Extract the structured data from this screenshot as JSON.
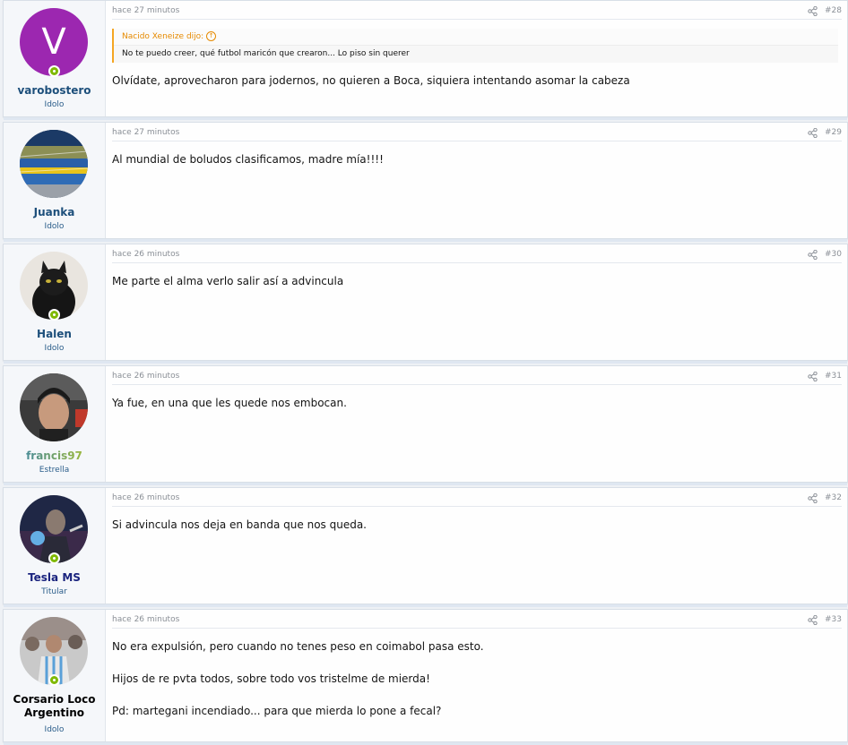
{
  "posts": [
    {
      "username": "varobostero",
      "user_title": "Idolo",
      "online": true,
      "time": "hace 27 minutos",
      "number": "#28",
      "quote": {
        "author": "Nacido Xeneize dijo:",
        "text": "No te puedo creer, qué futbol maricón que crearon... Lo piso sin querer"
      },
      "paragraphs": [
        "Olvídate, aprovecharon para jodernos, no quieren a Boca, siquiera intentando asomar la cabeza"
      ]
    },
    {
      "username": "Juanka",
      "user_title": "Idolo",
      "online": false,
      "time": "hace 27 minutos",
      "number": "#29",
      "paragraphs": [
        "Al mundial de boludos clasificamos, madre mía!!!!"
      ]
    },
    {
      "username": "Halen",
      "user_title": "Idolo",
      "online": true,
      "time": "hace 26 minutos",
      "number": "#30",
      "paragraphs": [
        "Me parte el alma verlo salir así a advincula"
      ]
    },
    {
      "username": "francis97",
      "user_title": "Estrella",
      "online": false,
      "time": "hace 26 minutos",
      "number": "#31",
      "paragraphs": [
        "Ya fue, en una que les quede nos embocan."
      ]
    },
    {
      "username": "Tesla MS",
      "user_title": "Titular",
      "online": true,
      "time": "hace 26 minutos",
      "number": "#32",
      "paragraphs": [
        "Si advincula nos deja en banda que nos queda."
      ]
    },
    {
      "username": "Corsario Loco Argentino",
      "user_title": "Idolo",
      "online": true,
      "time": "hace 26 minutos",
      "number": "#33",
      "paragraphs": [
        "No era expulsión, pero cuando no tenes peso en coimabol pasa esto.",
        "Hijos de re pvta todos, sobre todo vos tristelme de mierda!",
        "Pd: martegani incendiado... para que mierda lo pone a fecal?"
      ]
    }
  ],
  "colors": {
    "username": "#1d4f7b",
    "tesla_username": "#1a237e",
    "corsario_username": "#000000",
    "francis_gradient": [
      "#2b7bb9",
      "#b8c81a"
    ],
    "online_dot": "#7fb900",
    "quote_accent": "#e68a00"
  },
  "icons": {
    "share": "share-icon",
    "quote_jump": "arrow-up-circle-icon",
    "online": "online-status-icon"
  }
}
